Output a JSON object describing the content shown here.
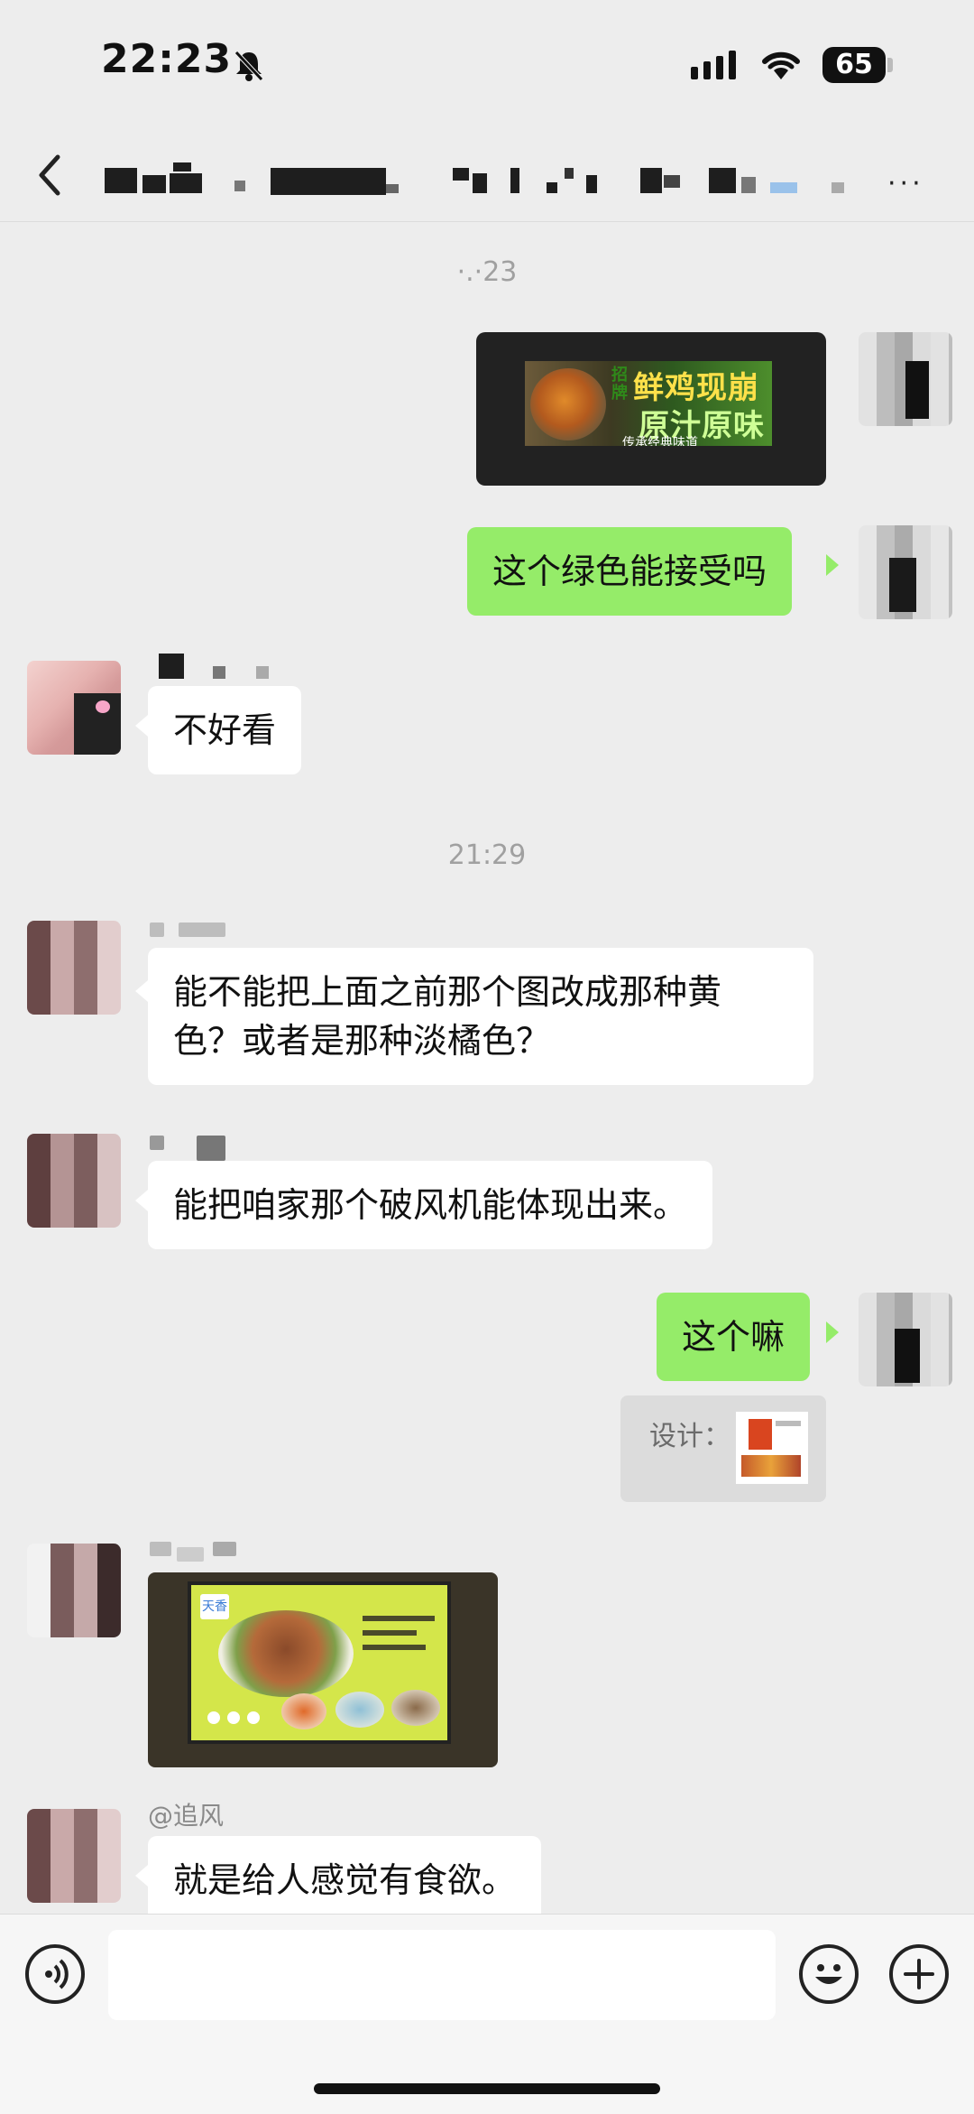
{
  "status_bar": {
    "time": "22:23",
    "battery": "65"
  },
  "header": {
    "more_label": "···"
  },
  "messages": {
    "time_1": "·.·23",
    "msg_green": "这个绿色能接受吗",
    "msg_bad": "不好看",
    "time_2": "21:29",
    "msg_q": "能不能把上面之前那个图改成那种黄色？或者是那种淡橘色？",
    "msg_fan": "能把咱家那个破风机能体现出来。",
    "msg_this": "这个嘛",
    "quote_label": "设计：",
    "mention": "@追风",
    "msg_appetite": "就是给人感觉有食欲。"
  },
  "sent_image_1": {
    "tag_left": "招牌",
    "title": "鲜鸡现崩",
    "subtitle": "原汁原味",
    "small": "传承经典味道"
  },
  "recv_image": {
    "logo": "天香"
  },
  "colors": {
    "bubble_self": "#95ec69",
    "bubble_other": "#ffffff",
    "background": "#ededed"
  }
}
